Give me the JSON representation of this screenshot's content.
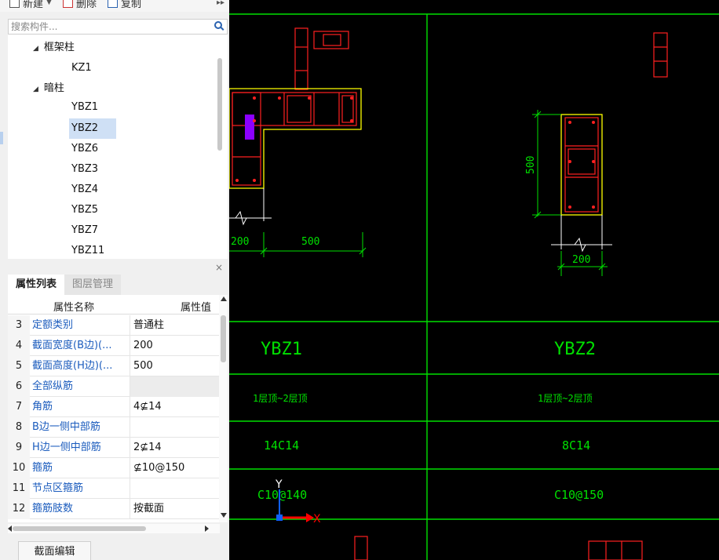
{
  "toolbar": {
    "new_label": "新建",
    "delete_label": "删除",
    "copy_label": "复制"
  },
  "search": {
    "placeholder": "搜索构件..."
  },
  "tree": {
    "groups": [
      {
        "label": "框架柱",
        "children": [
          "KZ1"
        ]
      },
      {
        "label": "暗柱",
        "children": [
          "YBZ1",
          "YBZ2",
          "YBZ6",
          "YBZ3",
          "YBZ4",
          "YBZ5",
          "YBZ7",
          "YBZ11"
        ]
      }
    ],
    "selected": "YBZ2"
  },
  "tabs": {
    "active": "属性列表",
    "inactive": "图层管理"
  },
  "properties": {
    "header_name": "属性名称",
    "header_value": "属性值",
    "rows": [
      {
        "num": "3",
        "name": "定额类别",
        "value": "普通柱"
      },
      {
        "num": "4",
        "name": "截面宽度(B边)(...",
        "value": "200"
      },
      {
        "num": "5",
        "name": "截面高度(H边)(...",
        "value": "500"
      },
      {
        "num": "6",
        "name": "全部纵筋",
        "value": ""
      },
      {
        "num": "7",
        "name": "角筋",
        "value": "4⊈14"
      },
      {
        "num": "8",
        "name": "B边一侧中部筋",
        "value": ""
      },
      {
        "num": "9",
        "name": "H边一侧中部筋",
        "value": "2⊈14"
      },
      {
        "num": "10",
        "name": "箍筋",
        "value": "⊈10@150"
      },
      {
        "num": "11",
        "name": "节点区箍筋",
        "value": ""
      },
      {
        "num": "12",
        "name": "箍筋肢数",
        "value": "按截面"
      }
    ]
  },
  "section_button": "截面编辑",
  "cad": {
    "dim_left_200": "200",
    "dim_left_500": "500",
    "dim_right_200": "200",
    "dim_right_500": "500",
    "col1_name": "YBZ1",
    "col2_name": "YBZ2",
    "col1_elev": "1层顶~2层顶",
    "col2_elev": "1层顶~2层顶",
    "col1_rebar": "14C14",
    "col2_rebar": "8C14",
    "col1_stirrup": "C10@140",
    "col2_stirrup": "C10@150",
    "axis_x": "X",
    "axis_y": "Y",
    "colors": {
      "grid": "#00e000",
      "outline": "#ffff00",
      "rebar": "#ff2020",
      "marker": "#8b00ff",
      "axis_x": "#ff0000",
      "axis_y": "#1060ff"
    }
  }
}
